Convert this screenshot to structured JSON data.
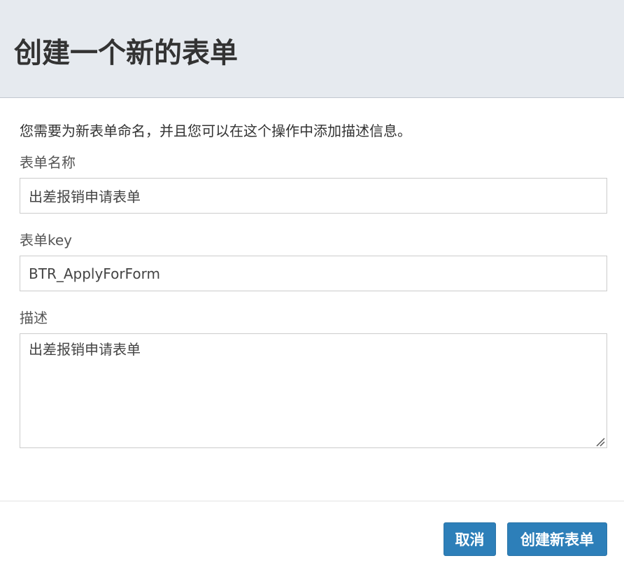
{
  "dialog": {
    "title": "创建一个新的表单",
    "intro": "您需要为新表单命名，并且您可以在这个操作中添加描述信息。"
  },
  "form": {
    "name_label": "表单名称",
    "name_value": "出差报销申请表单",
    "key_label": "表单key",
    "key_value": "BTR_ApplyForForm",
    "description_label": "描述",
    "description_value": "出差报销申请表单"
  },
  "footer": {
    "cancel_label": "取消",
    "create_label": "创建新表单"
  },
  "colors": {
    "header_background": "#e6eaef",
    "primary_button": "#2d7fb9",
    "input_border": "#cccccc"
  },
  "icons": {
    "textarea_resize": "resize-grip-icon"
  }
}
